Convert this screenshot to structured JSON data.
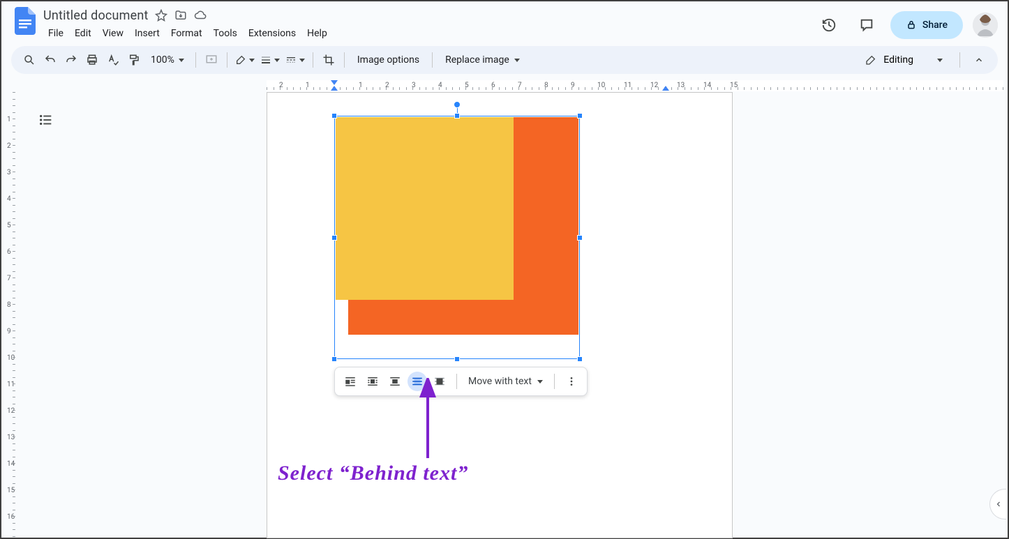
{
  "header": {
    "doc_title": "Untitled document",
    "menus": [
      "File",
      "Edit",
      "View",
      "Insert",
      "Format",
      "Tools",
      "Extensions",
      "Help"
    ],
    "share_label": "Share"
  },
  "toolbar": {
    "zoom": "100%",
    "image_options": "Image options",
    "replace_image": "Replace image",
    "mode": "Editing"
  },
  "ruler": {
    "h_labels": [
      {
        "v": "2",
        "neg": true
      },
      {
        "v": "1",
        "neg": true
      },
      {
        "v": "1",
        "neg": false
      },
      {
        "v": "2",
        "neg": false
      },
      {
        "v": "3",
        "neg": false
      },
      {
        "v": "4",
        "neg": false
      },
      {
        "v": "5",
        "neg": false
      },
      {
        "v": "6",
        "neg": false
      },
      {
        "v": "7",
        "neg": false
      },
      {
        "v": "8",
        "neg": false
      },
      {
        "v": "9",
        "neg": false
      },
      {
        "v": "10",
        "neg": false
      },
      {
        "v": "11",
        "neg": false
      },
      {
        "v": "12",
        "neg": false
      },
      {
        "v": "13",
        "neg": false
      },
      {
        "v": "14",
        "neg": false
      },
      {
        "v": "15",
        "neg": false
      }
    ],
    "v_labels": [
      "1",
      "2",
      "3",
      "4",
      "5",
      "6",
      "7",
      "8",
      "9",
      "10",
      "11",
      "12",
      "13",
      "14",
      "15",
      "16"
    ]
  },
  "image_toolbar": {
    "move_with_text": "Move with text"
  },
  "annotation": {
    "text": "Select “Behind text”"
  }
}
